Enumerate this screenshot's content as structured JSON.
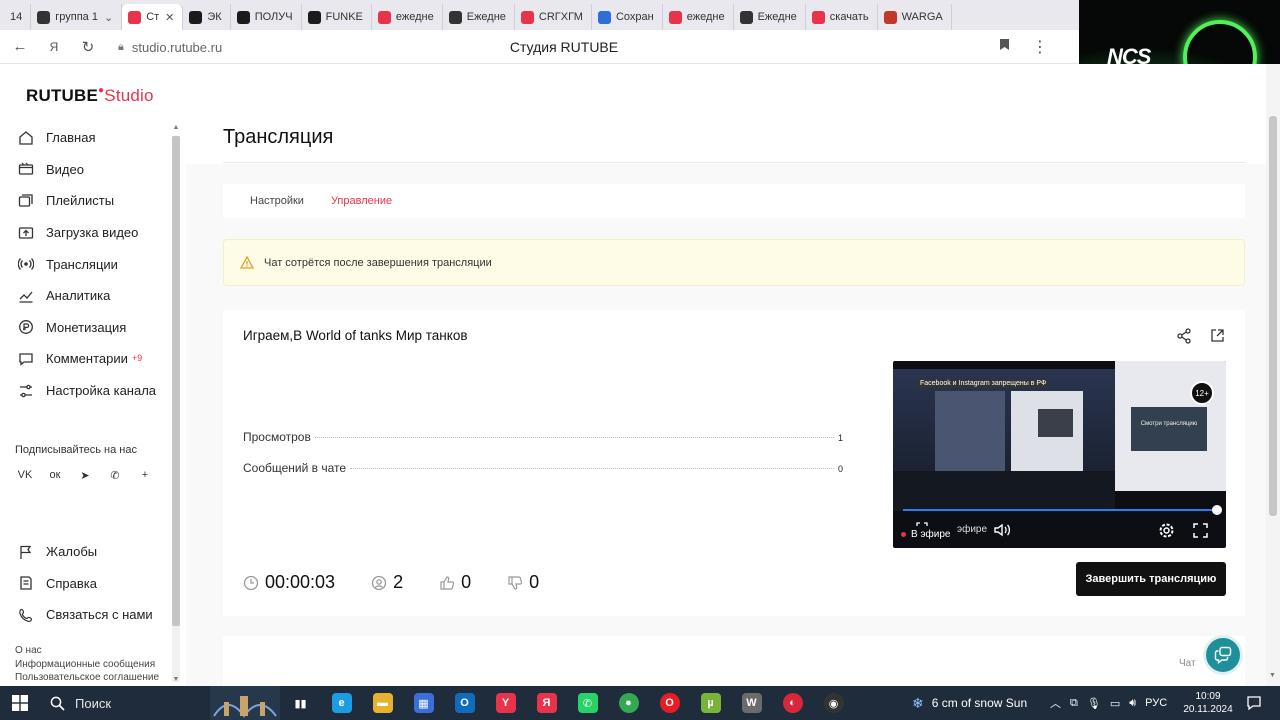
{
  "browser": {
    "tabs": [
      {
        "label": "14",
        "icon": "tab-counter",
        "color": "#d0d0d8"
      },
      {
        "label": "группа 1",
        "icon": "media-icon",
        "color": "#333333"
      },
      {
        "label": "Ст",
        "icon": "rutube-studio-favicon",
        "color": "#e8344b",
        "active": true
      },
      {
        "label": "ЭК",
        "icon": "rutube-favicon",
        "color": "#1b1b1b"
      },
      {
        "label": "ПОЛУЧ",
        "icon": "rutube-favicon",
        "color": "#1b1b1b"
      },
      {
        "label": "FUNKE",
        "icon": "rutube-favicon",
        "color": "#1b1b1b"
      },
      {
        "label": "ежедне",
        "icon": "yandex-favicon",
        "color": "#e8344b"
      },
      {
        "label": "Ежедне",
        "icon": "shield-favicon",
        "color": "#333333"
      },
      {
        "label": "CRГХГМ",
        "icon": "yandex-favicon",
        "color": "#e8344b"
      },
      {
        "label": "Сохран",
        "icon": "image-favicon",
        "color": "#2d6fd6"
      },
      {
        "label": "ежедне",
        "icon": "yandex-favicon",
        "color": "#e8344b"
      },
      {
        "label": "Ежедне",
        "icon": "shield-favicon",
        "color": "#333333"
      },
      {
        "label": "скачать",
        "icon": "yandex-favicon",
        "color": "#e8344b"
      },
      {
        "label": "WARGA",
        "icon": "wargaming-favicon",
        "color": "#c0392b"
      }
    ],
    "url": "studio.rutube.ru",
    "page_title": "Студия RUTUBE"
  },
  "overlay": {
    "logo": "NCS"
  },
  "sidebar": {
    "brand": "RUTUBE",
    "brand_suffix": "Studio",
    "items": [
      {
        "label": "Главная",
        "icon": "home-icon"
      },
      {
        "label": "Видео",
        "icon": "video-icon"
      },
      {
        "label": "Плейлисты",
        "icon": "playlist-icon"
      },
      {
        "label": "Загрузка видео",
        "icon": "upload-icon"
      },
      {
        "label": "Трансляции",
        "icon": "broadcast-icon"
      },
      {
        "label": "Аналитика",
        "icon": "analytics-icon"
      },
      {
        "label": "Монетизация",
        "icon": "money-icon"
      },
      {
        "label": "Комментарии",
        "icon": "comments-icon",
        "count": "+9"
      },
      {
        "label": "Настройка канала",
        "icon": "settings-icon"
      }
    ],
    "subscribe_label": "Подписывайтесь на нас",
    "socials": [
      "vk-icon",
      "ok-icon",
      "telegram-icon",
      "viber-icon",
      "plus-icon"
    ],
    "social_glyphs": [
      "VK",
      "ок",
      "➤",
      "✆",
      "+"
    ],
    "secondary": [
      {
        "label": "Жалобы",
        "icon": "flag-icon"
      },
      {
        "label": "Справка",
        "icon": "help-icon"
      },
      {
        "label": "Связаться с нами",
        "icon": "contact-icon"
      }
    ],
    "footer_links": [
      "О нас",
      "Информационные сообщения",
      "Пользовательское соглашение"
    ]
  },
  "main": {
    "title": "Трансляция",
    "tabs": [
      {
        "label": "Настройки",
        "active": false
      },
      {
        "label": "Управление",
        "active": true
      }
    ],
    "alert": "Чат сотрётся после завершения трансляции",
    "stream": {
      "title": "Играем,В World of tanks Мир танков",
      "stats": [
        {
          "label": "Просмотров",
          "value": "1"
        },
        {
          "label": "Сообщений в чате",
          "value": "0"
        }
      ],
      "duration": "00:00:03",
      "viewers": "2",
      "likes": "0",
      "dislikes": "0",
      "live_label": "В эфире",
      "ghost_label": "эфире",
      "end_button": "Завершить трансляцию",
      "player": {
        "banner": "Facebook и Instagram запрещены в РФ",
        "age_rating": "12+",
        "box_text": "Смотри трансляцию"
      }
    },
    "chat_label": "Чат"
  },
  "taskbar": {
    "search_label": "Поиск",
    "apps": [
      {
        "icon": "task-view-icon",
        "color": "#1e2c3c",
        "glyph": "▮▮"
      },
      {
        "icon": "edge-icon",
        "color": "#1b9de2",
        "glyph": "e"
      },
      {
        "icon": "explorer-icon",
        "color": "#e8b230",
        "glyph": "▬"
      },
      {
        "icon": "store-icon",
        "color": "#3a6fd8",
        "glyph": "▦"
      },
      {
        "icon": "outlook-icon",
        "color": "#0f6cbd",
        "glyph": "O"
      },
      {
        "icon": "yandex-browser-icon",
        "color": "#e8344b",
        "glyph": "Y"
      },
      {
        "icon": "yandex-icon",
        "color": "#e8344b",
        "glyph": "Я"
      },
      {
        "icon": "whatsapp-icon",
        "color": "#25d366",
        "glyph": "✆"
      },
      {
        "icon": "chrome-icon",
        "color": "#34a853",
        "glyph": "●"
      },
      {
        "icon": "opera-icon",
        "color": "#e81c24",
        "glyph": "O"
      },
      {
        "icon": "utorrent-icon",
        "color": "#78b33a",
        "glyph": "µ"
      },
      {
        "icon": "wot-icon",
        "color": "#6b6b6b",
        "glyph": "W"
      },
      {
        "icon": "speed-icon",
        "color": "#d6283a",
        "glyph": "◐"
      },
      {
        "icon": "obs-icon",
        "color": "#333333",
        "glyph": "◉"
      }
    ],
    "weather": "6 cm of snow Sun",
    "lang": "РУС",
    "time": "10:09",
    "date": "20.11.2024"
  }
}
